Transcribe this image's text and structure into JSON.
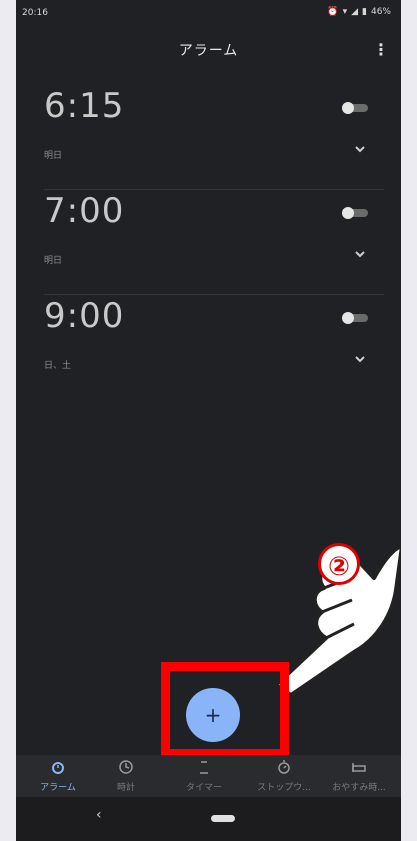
{
  "status_bar": {
    "time": "20:16",
    "battery": "46%"
  },
  "app_bar": {
    "title": "アラーム",
    "more_icon": "more-vert-icon"
  },
  "alarms": [
    {
      "time": "6:15",
      "days": "明日",
      "enabled": false
    },
    {
      "time": "7:00",
      "days": "明日",
      "enabled": false
    },
    {
      "time": "9:00",
      "days": "日、土",
      "enabled": false
    }
  ],
  "fab": {
    "label": "+"
  },
  "annotation": {
    "step_number": "②"
  },
  "bottom_nav": [
    {
      "label": "アラーム",
      "icon": "alarm-icon",
      "active": true
    },
    {
      "label": "時計",
      "icon": "clock-icon",
      "active": false
    },
    {
      "label": "タイマー",
      "icon": "timer-icon",
      "active": false
    },
    {
      "label": "ストップウ...",
      "icon": "stopwatch-icon",
      "active": false
    },
    {
      "label": "おやすみ時...",
      "icon": "bedtime-icon",
      "active": false
    }
  ],
  "colors": {
    "background": "#202124",
    "accent": "#8ab4f8",
    "highlight": "#ff0000"
  }
}
